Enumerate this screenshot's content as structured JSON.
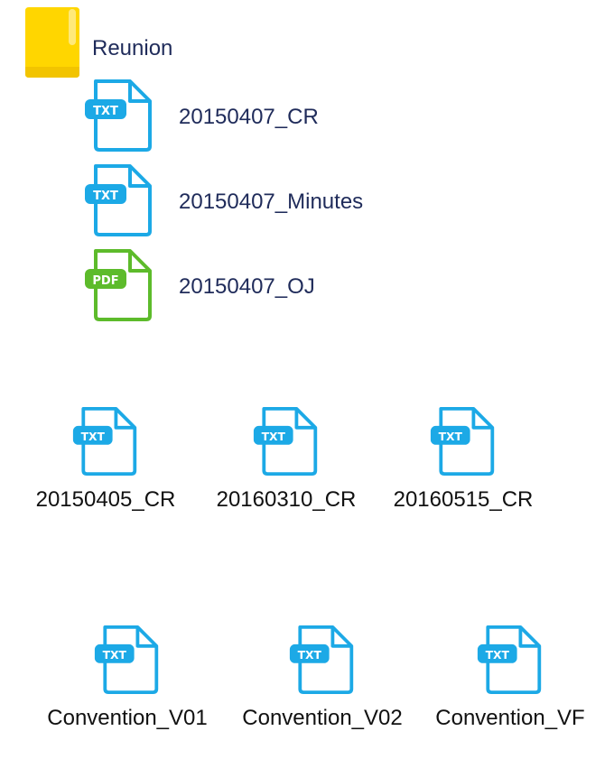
{
  "folder": {
    "name": "Reunion",
    "icon": "folder-icon",
    "color": "#FFD600",
    "children": [
      {
        "name": "20150407_CR",
        "type": "TXT",
        "icon": "txt-file-icon"
      },
      {
        "name": "20150407_Minutes",
        "type": "TXT",
        "icon": "txt-file-icon"
      },
      {
        "name": "20150407_OJ",
        "type": "PDF",
        "icon": "pdf-file-icon"
      }
    ]
  },
  "cr_files": [
    {
      "name": "20150405_CR",
      "type": "TXT",
      "icon": "txt-file-icon"
    },
    {
      "name": "20160310_CR",
      "type": "TXT",
      "icon": "txt-file-icon"
    },
    {
      "name": "20160515_CR",
      "type": "TXT",
      "icon": "txt-file-icon"
    }
  ],
  "convention_files": [
    {
      "name": "Convention_V01",
      "type": "TXT",
      "icon": "txt-file-icon"
    },
    {
      "name": "Convention_V02",
      "type": "TXT",
      "icon": "txt-file-icon"
    },
    {
      "name": "Convention_VF",
      "type": "TXT",
      "icon": "txt-file-icon"
    }
  ],
  "colors": {
    "txt": "#1CA9E6",
    "pdf": "#5DBB2B",
    "folder": "#FFD600"
  }
}
